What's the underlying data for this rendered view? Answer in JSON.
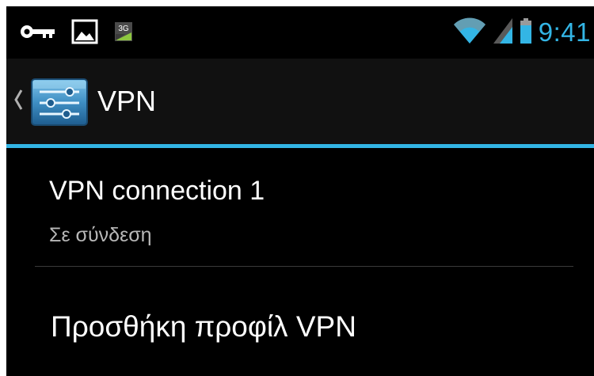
{
  "status_bar": {
    "time": "9:41",
    "left_icons": [
      "key-icon",
      "image-icon",
      "network-3g-icon"
    ],
    "right_icons": [
      "wifi-icon",
      "signal-icon",
      "battery-icon"
    ],
    "network_badge": "3G",
    "accent_color": "#33b5e5"
  },
  "action_bar": {
    "title": "VPN",
    "icon": "settings-sliders-icon"
  },
  "vpn_list": {
    "items": [
      {
        "title": "VPN connection 1",
        "status": "Σε σύνδεση"
      }
    ],
    "add_profile_label": "Προσθήκη προφίλ VPN"
  }
}
